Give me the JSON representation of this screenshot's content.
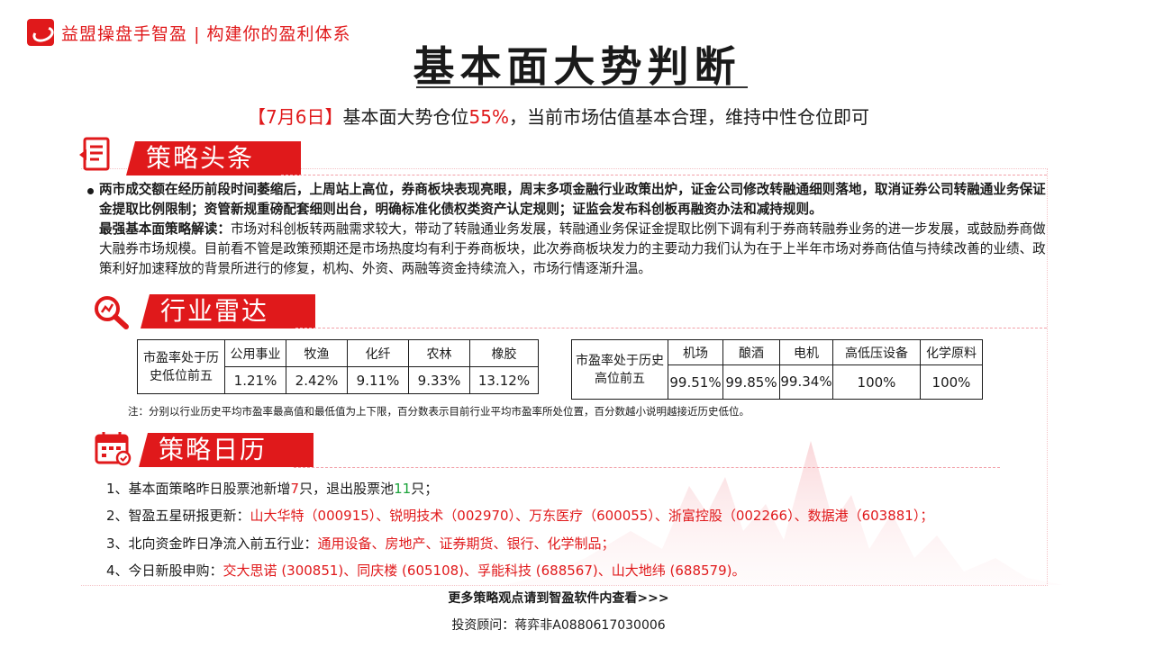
{
  "brand": {
    "name": "益盟操盘手智盈",
    "slogan": "构建你的盈利体系",
    "separator": "|"
  },
  "title": "基本面大势判断",
  "headline": {
    "date": "【7月6日】",
    "prefix": "基本面大势仓位",
    "percent": "55%",
    "suffix": "，当前市场估值基本合理，维持中性仓位即可"
  },
  "sections": {
    "strategy": "策略头条",
    "radar": "行业雷达",
    "calendar": "策略日历"
  },
  "strategy": {
    "lead": "两市成交额在经历前段时间萎缩后，上周站上高位，券商板块表现亮眼，周末多项金融行业政策出炉，证金公司修改转融通细则落地，取消证券公司转融通业务保证金提取比例限制；资管新规重磅配套细则出台，明确标准化债权类资产认定规则；证监会发布科创板再融资办法和减持规则。",
    "label": "最强基本面策略解读：",
    "body": "市场对科创板转两融需求较大，带动了转融通业务发展，转融通业务保证金提取比例下调有利于券商转融券业务的进一步发展，或鼓励券商做大融券市场规模。目前看不管是政策预期还是市场热度均有利于券商板块，此次券商板块发力的主要动力我们认为在于上半年市场对券商估值与持续改善的业绩、政策利好加速释放的背景所进行的修复，机构、外资、两融等资金持续流入，市场行情逐渐升温。"
  },
  "radar": {
    "low": {
      "label": "市盈率处于历史低位前五",
      "headers": [
        "公用事业",
        "牧渔",
        "化纤",
        "农林",
        "橡胶"
      ],
      "values": [
        "1.21%",
        "2.42%",
        "9.11%",
        "9.33%",
        "13.12%"
      ]
    },
    "high": {
      "label": "市盈率处于历史高位前五",
      "headers": [
        "机场",
        "酿酒",
        "电机",
        "高低压设备",
        "化学原料"
      ],
      "values": [
        "99.51%",
        "99.85%",
        "99.34%",
        "100%",
        "100%"
      ]
    },
    "note": "注：分别以行业历史平均市盈率最高值和最低值为上下限，百分数表示目前行业平均市盈率所处位置，百分数越小说明越接近历史低位。"
  },
  "calendar": {
    "item1": {
      "prefix": "1、基本面策略昨日股票池新增",
      "added": "7",
      "mid": "只，退出股票池",
      "removed": "11",
      "suffix": "只；"
    },
    "item2": {
      "prefix": "2、智盈五星研报更新：",
      "content": "山大华特（000915）、锐明技术（002970）、万东医疗（600055）、浙富控股（002266）、数据港（603881）；"
    },
    "item3": {
      "prefix": "3、北向资金昨日净流入前五行业：",
      "content": "通用设备、房地产、证券期货、银行、化学制品；"
    },
    "item4": {
      "prefix": "4、今日新股申购：",
      "content": "交大思诺 (300851)、同庆楼 (605108)、孚能科技 (688567)、山大地纬 (688579)。"
    }
  },
  "footer": {
    "more": "更多策略观点请到智盈软件内查看>>>",
    "advisor": "投资顾问：蒋弈非A0880617030006"
  },
  "colors": {
    "accent": "#e0191b",
    "green": "#1aa33a"
  }
}
